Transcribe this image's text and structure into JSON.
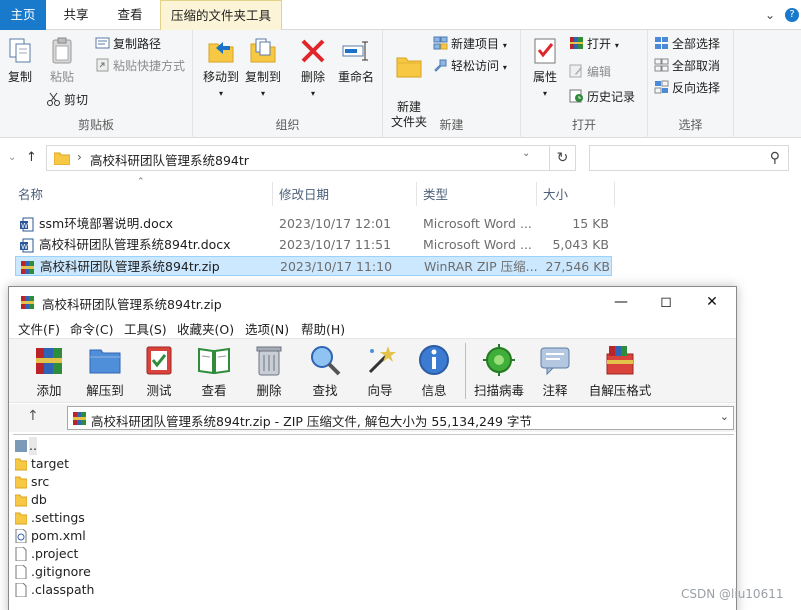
{
  "explorer": {
    "tabs": {
      "home": "主页",
      "share": "共享",
      "view": "查看",
      "context": "压缩的文件夹工具"
    },
    "ribbon": {
      "clipboard": {
        "label": "剪贴板",
        "copy": "复制",
        "paste": "粘贴",
        "copy_path": "复制路径",
        "paste_shortcut": "粘贴快捷方式",
        "cut": "剪切"
      },
      "organize": {
        "label": "组织",
        "move_to": "移动到",
        "copy_to": "复制到",
        "delete": "删除",
        "rename": "重命名"
      },
      "new": {
        "label": "新建",
        "new_folder": "新建\n文件夹",
        "new_item": "新建项目",
        "easy_access": "轻松访问"
      },
      "open": {
        "label": "打开",
        "properties": "属性",
        "open": "打开",
        "edit": "编辑",
        "history": "历史记录"
      },
      "select": {
        "label": "选择",
        "select_all": "全部选择",
        "select_none": "全部取消",
        "invert": "反向选择"
      }
    },
    "address": {
      "path": "高校科研团队管理系统894tr"
    },
    "columns": {
      "name": "名称",
      "date": "修改日期",
      "type": "类型",
      "size": "大小"
    },
    "files": [
      {
        "name": "ssm环境部署说明.docx",
        "date": "2023/10/17 12:01",
        "type": "Microsoft Word ...",
        "size": "15 KB",
        "icon": "word-icon"
      },
      {
        "name": "高校科研团队管理系统894tr.docx",
        "date": "2023/10/17 11:51",
        "type": "Microsoft Word ...",
        "size": "5,043 KB",
        "icon": "word-icon"
      },
      {
        "name": "高校科研团队管理系统894tr.zip",
        "date": "2023/10/17 11:10",
        "type": "WinRAR ZIP 压缩...",
        "size": "27,546 KB",
        "icon": "winrar-icon",
        "selected": true
      }
    ]
  },
  "winrar": {
    "title": "高校科研团队管理系统894tr.zip",
    "menu": [
      "文件(F)",
      "命令(C)",
      "工具(S)",
      "收藏夹(O)",
      "选项(N)",
      "帮助(H)"
    ],
    "toolbar": {
      "add": "添加",
      "extract_to": "解压到",
      "test": "测试",
      "view": "查看",
      "delete": "删除",
      "find": "查找",
      "wizard": "向导",
      "info": "信息",
      "virus_scan": "扫描病毒",
      "comment": "注释",
      "sfx": "自解压格式"
    },
    "path_text": "高校科研团队管理系统894tr.zip - ZIP 压缩文件, 解包大小为 55,134,249 字节",
    "items": [
      {
        "name": "..",
        "kind": "up"
      },
      {
        "name": "target",
        "kind": "folder"
      },
      {
        "name": "src",
        "kind": "folder"
      },
      {
        "name": "db",
        "kind": "folder"
      },
      {
        "name": ".settings",
        "kind": "folder"
      },
      {
        "name": "pom.xml",
        "kind": "xml"
      },
      {
        "name": ".project",
        "kind": "file"
      },
      {
        "name": ".gitignore",
        "kind": "file"
      },
      {
        "name": ".classpath",
        "kind": "file"
      }
    ]
  },
  "watermark": "CSDN @liu10611",
  "colors": {
    "home_tab": "#1979ca",
    "selected_row": "#cce8ff",
    "context_tab": "#fbf4d6"
  }
}
